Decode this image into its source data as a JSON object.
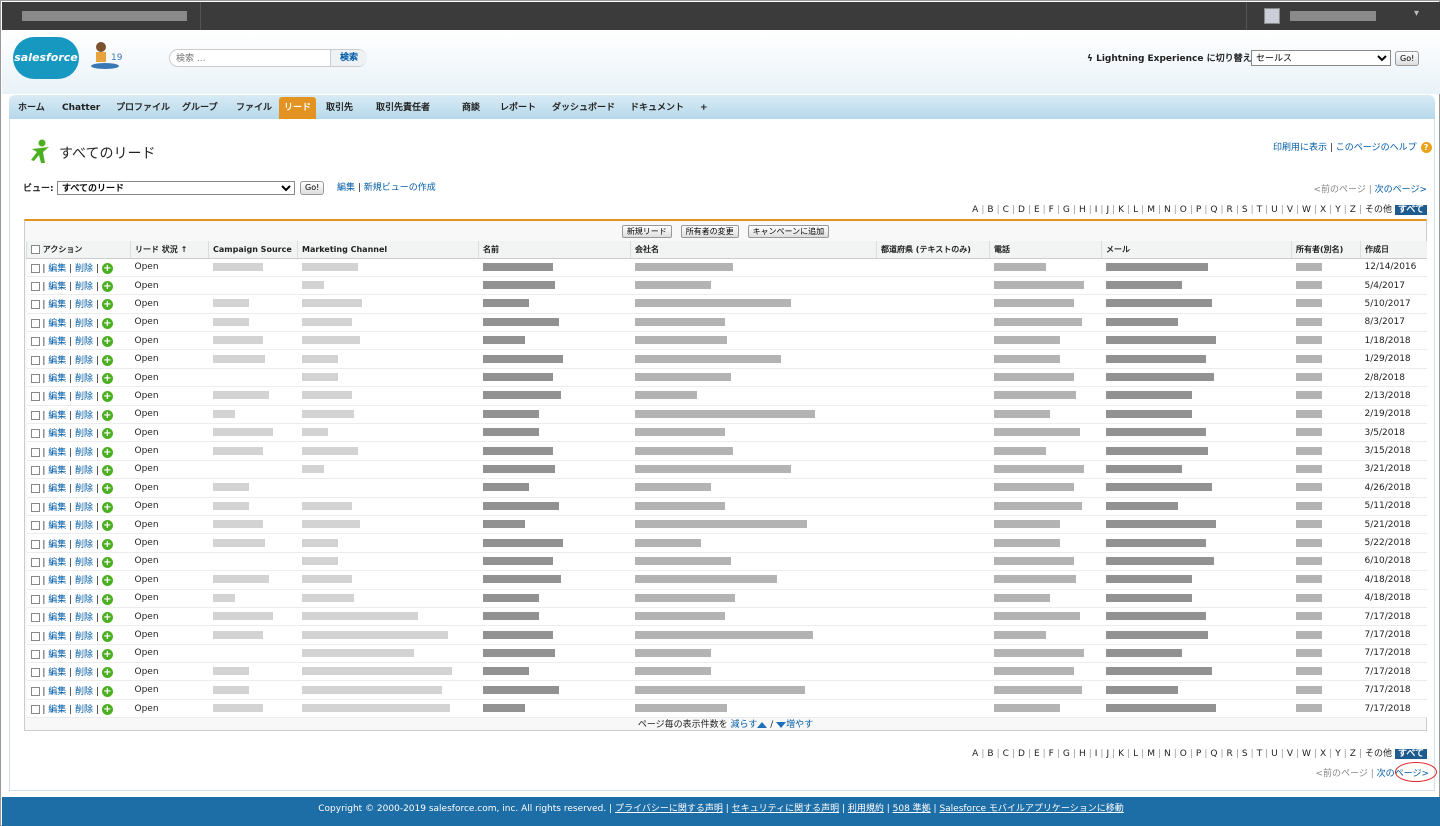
{
  "header": {
    "logo_text": "salesforce",
    "search_placeholder": "検索 ...",
    "search_button": "検索",
    "lightning_switch": "Lightning Experience に切り替え",
    "app_selected": "セールス",
    "go_label": "Go!"
  },
  "tabs": [
    {
      "label": "ホーム"
    },
    {
      "label": "Chatter"
    },
    {
      "label": "プロファイル"
    },
    {
      "label": "グループ"
    },
    {
      "label": "ファイル"
    },
    {
      "label": "リード"
    },
    {
      "label": "取引先"
    },
    {
      "label": "取引先責任者"
    },
    {
      "label": "商談"
    },
    {
      "label": "レポート"
    },
    {
      "label": "ダッシュボード"
    },
    {
      "label": "ドキュメント"
    },
    {
      "label": "+"
    }
  ],
  "page": {
    "title": "すべてのリード",
    "print_link": "印刷用に表示",
    "help_link": "このページのヘルプ",
    "view_label": "ビュー:",
    "view_selected": "すべてのリード",
    "edit_link": "編集",
    "new_view_link": "新規ビューの作成",
    "prev_page": "<前のページ",
    "next_page": "次のページ>"
  },
  "alphabet": [
    "A",
    "B",
    "C",
    "D",
    "E",
    "F",
    "G",
    "H",
    "I",
    "J",
    "K",
    "L",
    "M",
    "N",
    "O",
    "P",
    "Q",
    "R",
    "S",
    "T",
    "U",
    "V",
    "W",
    "X",
    "Y",
    "Z",
    "その他"
  ],
  "alphabet_all": "すべて",
  "list_buttons": {
    "new_lead": "新規リード",
    "change_owner": "所有者の変更",
    "add_campaign": "キャンペーンに追加"
  },
  "columns": {
    "action": "アクション",
    "status": "リード 状況 ↑",
    "campaign": "Campaign Source",
    "channel": "Marketing Channel",
    "name": "名前",
    "company": "会社名",
    "prefecture": "都道府県 (テキストのみ)",
    "phone": "電話",
    "email": "メール",
    "owner": "所有者(別名)",
    "created": "作成日"
  },
  "row_actions": {
    "edit": "編集",
    "delete": "削除",
    "separator": "|"
  },
  "rows": [
    {
      "status": "Open",
      "created": "12/14/2016"
    },
    {
      "status": "Open",
      "created": "5/4/2017"
    },
    {
      "status": "Open",
      "created": "5/10/2017"
    },
    {
      "status": "Open",
      "created": "8/3/2017"
    },
    {
      "status": "Open",
      "created": "1/18/2018"
    },
    {
      "status": "Open",
      "created": "1/29/2018"
    },
    {
      "status": "Open",
      "created": "2/8/2018"
    },
    {
      "status": "Open",
      "created": "2/13/2018"
    },
    {
      "status": "Open",
      "created": "2/19/2018"
    },
    {
      "status": "Open",
      "created": "3/5/2018"
    },
    {
      "status": "Open",
      "created": "3/15/2018"
    },
    {
      "status": "Open",
      "created": "3/21/2018"
    },
    {
      "status": "Open",
      "created": "4/26/2018"
    },
    {
      "status": "Open",
      "created": "5/11/2018"
    },
    {
      "status": "Open",
      "created": "5/21/2018"
    },
    {
      "status": "Open",
      "created": "5/22/2018"
    },
    {
      "status": "Open",
      "created": "6/10/2018"
    },
    {
      "status": "Open",
      "created": "4/18/2018"
    },
    {
      "status": "Open",
      "created": "4/18/2018"
    },
    {
      "status": "Open",
      "created": "7/17/2018"
    },
    {
      "status": "Open",
      "created": "7/17/2018"
    },
    {
      "status": "Open",
      "created": "7/17/2018"
    },
    {
      "status": "Open",
      "created": "7/17/2018"
    },
    {
      "status": "Open",
      "created": "7/17/2018"
    },
    {
      "status": "Open",
      "created": "7/17/2018"
    }
  ],
  "per_page": {
    "label": "ページ毎の表示件数を",
    "fewer": "減らす",
    "slash": "/",
    "more": "増やす"
  },
  "footer": {
    "copyright": "Copyright © 2000-2019 salesforce.com, inc. All rights reserved.",
    "privacy": "プライバシーに関する声明",
    "security": "セキュリティに関する声明",
    "terms": "利用規約",
    "compliance": "508 準拠",
    "mobile": "Salesforce モバイルアプリケーションに移動"
  }
}
